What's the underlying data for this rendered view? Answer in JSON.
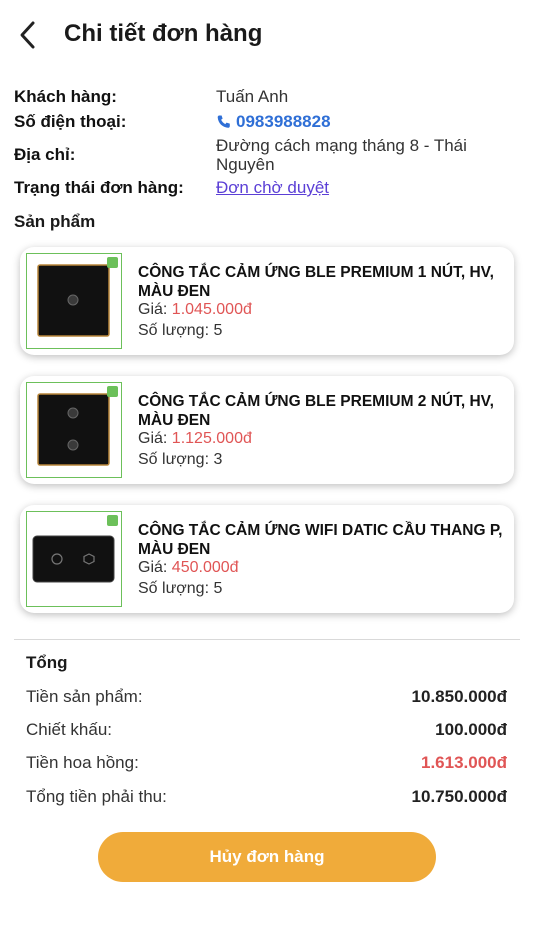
{
  "header": {
    "title": "Chi tiết đơn hàng"
  },
  "order": {
    "customer_label": "Khách hàng:",
    "customer_value": "Tuấn Anh",
    "phone_label": "Số điện thoại:",
    "phone_value": "0983988828",
    "address_label": "Địa chỉ:",
    "address_value": "Đường cách mạng tháng 8 - Thái Nguyên",
    "status_label": "Trạng thái đơn hàng:",
    "status_value": "Đơn chờ duyệt"
  },
  "products_label": "Sản phẩm",
  "products": [
    {
      "name": "CÔNG TẮC CẢM ỨNG BLE PREMIUM 1 NÚT, HV, MÀU ĐEN",
      "price_label": "Giá:",
      "price": "1.045.000đ",
      "qty_label": "Số lượng:",
      "qty": "5"
    },
    {
      "name": "CÔNG TẮC CẢM ỨNG BLE PREMIUM 2 NÚT, HV, MÀU ĐEN",
      "price_label": "Giá:",
      "price": "1.125.000đ",
      "qty_label": "Số lượng:",
      "qty": "3"
    },
    {
      "name": "CÔNG TẮC CẢM ỨNG WIFI DATIC CẦU THANG P, MÀU ĐEN",
      "price_label": "Giá:",
      "price": "450.000đ",
      "qty_label": "Số lượng:",
      "qty": "5"
    }
  ],
  "totals": {
    "title": "Tổng",
    "product_label": "Tiền sản phẩm:",
    "product_value": "10.850.000đ",
    "discount_label": "Chiết khấu:",
    "discount_value": "100.000đ",
    "commission_label": "Tiền hoa hồng:",
    "commission_value": "1.613.000đ",
    "receivable_label": "Tổng tiền phải thu:",
    "receivable_value": "10.750.000đ"
  },
  "cancel_button": "Hủy đơn hàng",
  "colors": {
    "accent": "#f0ab3a",
    "price": "#e05555",
    "phone": "#2f6fd6",
    "link": "#5b3fd6"
  },
  "icons": {
    "back": "chevron-left-icon",
    "phone": "phone-icon"
  }
}
